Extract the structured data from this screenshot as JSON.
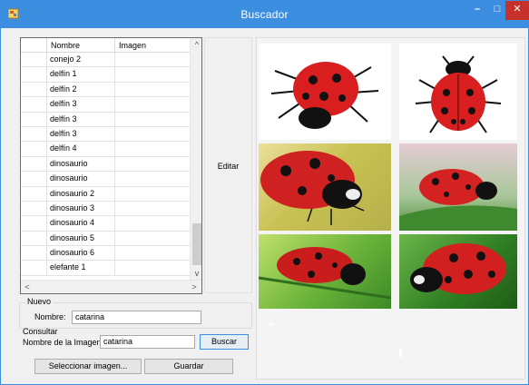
{
  "window": {
    "title": "Buscador",
    "minimize_glyph": "–",
    "maximize_glyph": "□",
    "close_glyph": "✕",
    "accent": "#3c8fe0",
    "close_color": "#c7312b"
  },
  "grid": {
    "columns": [
      "Nombre",
      "Imagen"
    ],
    "rows": [
      {
        "nombre": "conejo 2"
      },
      {
        "nombre": "delfín 1"
      },
      {
        "nombre": "delfín 2"
      },
      {
        "nombre": "delfín 3"
      },
      {
        "nombre": "delfín 3"
      },
      {
        "nombre": "delfín 3"
      },
      {
        "nombre": "delfín 4"
      },
      {
        "nombre": "dinosaurio"
      },
      {
        "nombre": "dinosaurio"
      },
      {
        "nombre": "dinosaurio 2"
      },
      {
        "nombre": "dinosaurio 3"
      },
      {
        "nombre": "dinosaurio 4"
      },
      {
        "nombre": "dinosaurio 5"
      },
      {
        "nombre": "dinosaurio 6"
      },
      {
        "nombre": "elefante 1"
      }
    ],
    "scroll": {
      "up_glyph": "^",
      "down_glyph": "v",
      "left_glyph": "<",
      "right_glyph": ">"
    }
  },
  "edit_button": {
    "label": "Editar"
  },
  "nuevo": {
    "legend": "Nuevo",
    "nombre_label": "Nombre:",
    "nombre_value": "catarina"
  },
  "consultar": {
    "legend": "Consultar",
    "label": "Nombre de la Imagen:",
    "value": "catarina",
    "buscar_label": "Buscar"
  },
  "actions": {
    "select_label": "Seleccionar imagen...",
    "save_label": "Guardar"
  },
  "images": [
    {
      "name": "ladybug-image-1"
    },
    {
      "name": "ladybug-image-2"
    },
    {
      "name": "ladybug-image-3"
    },
    {
      "name": "ladybug-image-4"
    },
    {
      "name": "ladybug-image-5"
    },
    {
      "name": "ladybug-image-6"
    }
  ]
}
